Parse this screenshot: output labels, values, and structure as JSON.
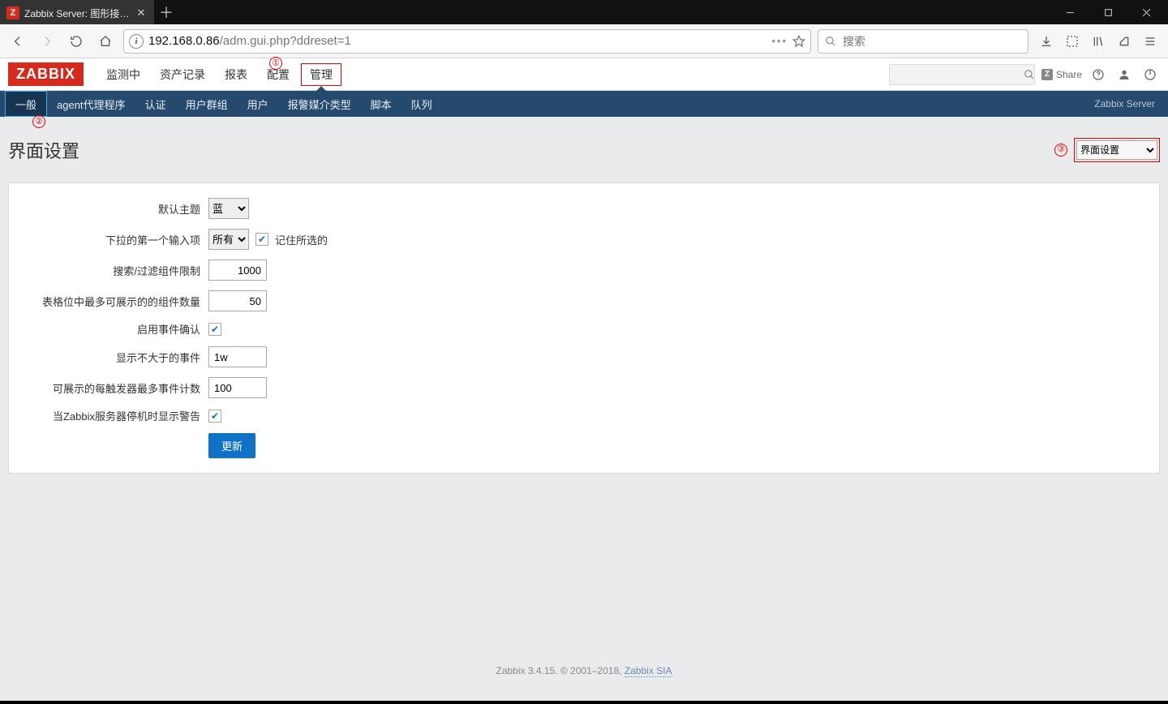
{
  "browser": {
    "tab_title": "Zabbix Server: 图形接口的配",
    "url_prefix": "192.168.0.86",
    "url_suffix": "/adm.gui.php?ddreset=1",
    "search_placeholder": "搜索"
  },
  "window_controls": {
    "min": "—",
    "max": "▢",
    "close": "✕"
  },
  "annotations": {
    "a1": "①",
    "a2": "②",
    "a3": "③"
  },
  "zabbix": {
    "logo": "ZABBIX",
    "topnav": [
      "监测中",
      "资产记录",
      "报表",
      "配置",
      "管理"
    ],
    "topnav_active": 4,
    "share": "Share",
    "server_label": "Zabbix Server"
  },
  "subnav": {
    "items": [
      "一般",
      "agent代理程序",
      "认证",
      "用户群组",
      "用户",
      "报警媒介类型",
      "脚本",
      "队列"
    ],
    "active": 0
  },
  "page": {
    "title": "界面设置",
    "dropdown_value": "界面设置"
  },
  "form": {
    "labels": {
      "theme": "默认主题",
      "first_entry": "下拉的第一个输入项",
      "remember": "记住所选的",
      "search_limit": "搜索/过滤组件限制",
      "table_limit": "表格位中最多可展示的的组件数量",
      "ack": "启用事件确认",
      "events_older": "显示不大于的事件",
      "events_per_trigger": "可展示的每触发器最多事件计数",
      "warn_down": "当Zabbix服务器停机时显示警告"
    },
    "values": {
      "theme": "蓝",
      "first_entry": "所有",
      "remember_checked": true,
      "search_limit": "1000",
      "table_limit": "50",
      "ack_checked": true,
      "events_older": "1w",
      "events_per_trigger": "100",
      "warn_down_checked": true
    },
    "submit": "更新"
  },
  "footer": {
    "text_a": "Zabbix 3.4.15. © 2001–2018, ",
    "link": "Zabbix SIA"
  }
}
